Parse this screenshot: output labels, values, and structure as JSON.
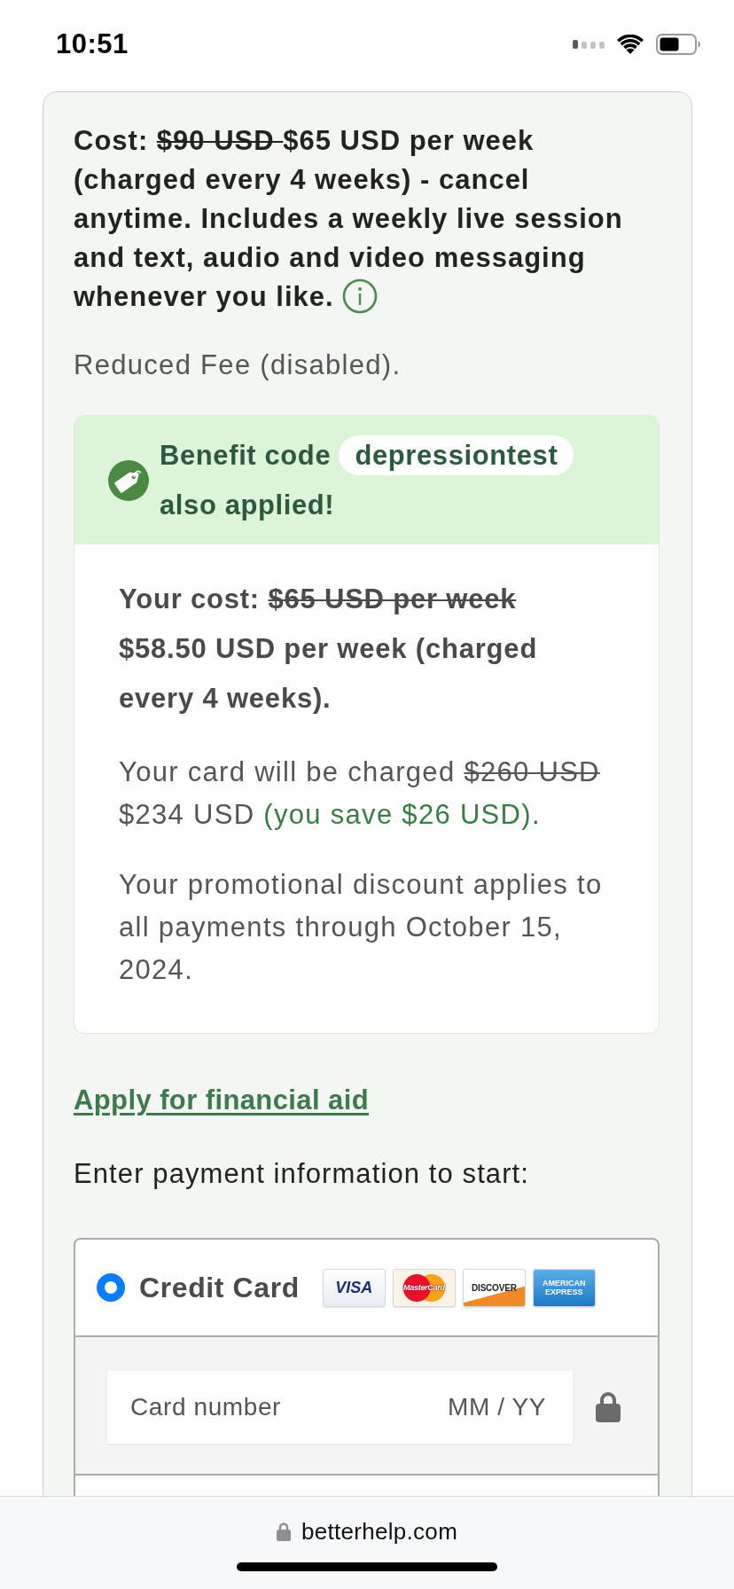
{
  "status_bar": {
    "time": "10:51"
  },
  "plan": {
    "summary": [
      {
        "text": "Cost: ",
        "kind": "plain"
      },
      {
        "text": "$90 USD ",
        "kind": "struck"
      },
      {
        "text": "$65 USD per week (charged every 4 weeks) - cancel anytime. Includes a weekly live session and text, audio and video messaging whenever you like.",
        "kind": "plain"
      }
    ],
    "note": "Reduced Fee (disabled)."
  },
  "benefit": {
    "label": "Benefit code",
    "code": "depressiontest",
    "suffix": "also applied!",
    "your_cost": [
      {
        "text": "Your cost: ",
        "kind": "plain"
      },
      {
        "text": "$65 USD per week",
        "kind": "struck"
      },
      {
        "text": " $58.50 USD per week (charged every 4 weeks).",
        "kind": "plain"
      }
    ],
    "charge": [
      {
        "text": "Your card will be charged ",
        "kind": "plain"
      },
      {
        "text": "$260 USD",
        "kind": "struck"
      },
      {
        "text": " $234 USD ",
        "kind": "plain"
      },
      {
        "text": "(you save $26 USD)",
        "kind": "savings"
      },
      {
        "text": ".",
        "kind": "plain"
      }
    ],
    "promo_note": "Your promotional discount applies to all payments through October 15, 2024."
  },
  "financial_aid": {
    "link": "Apply for financial aid"
  },
  "payment": {
    "prompt": "Enter payment information to start:",
    "methods": [
      {
        "label": "Credit Card",
        "selected": true,
        "card_brands": [
          {
            "kind": "visa",
            "text": "VISA"
          },
          {
            "kind": "mastercard",
            "text": "MasterCard"
          },
          {
            "kind": "discover",
            "text": "DISCOVER"
          },
          {
            "kind": "amex",
            "text": "AMERICAN EXPRESS"
          }
        ]
      }
    ],
    "card_number": {
      "placeholder": "Card number"
    },
    "expiry": {
      "placeholder": "MM / YY"
    }
  },
  "browser_bar": {
    "url": "betterhelp.com"
  }
}
